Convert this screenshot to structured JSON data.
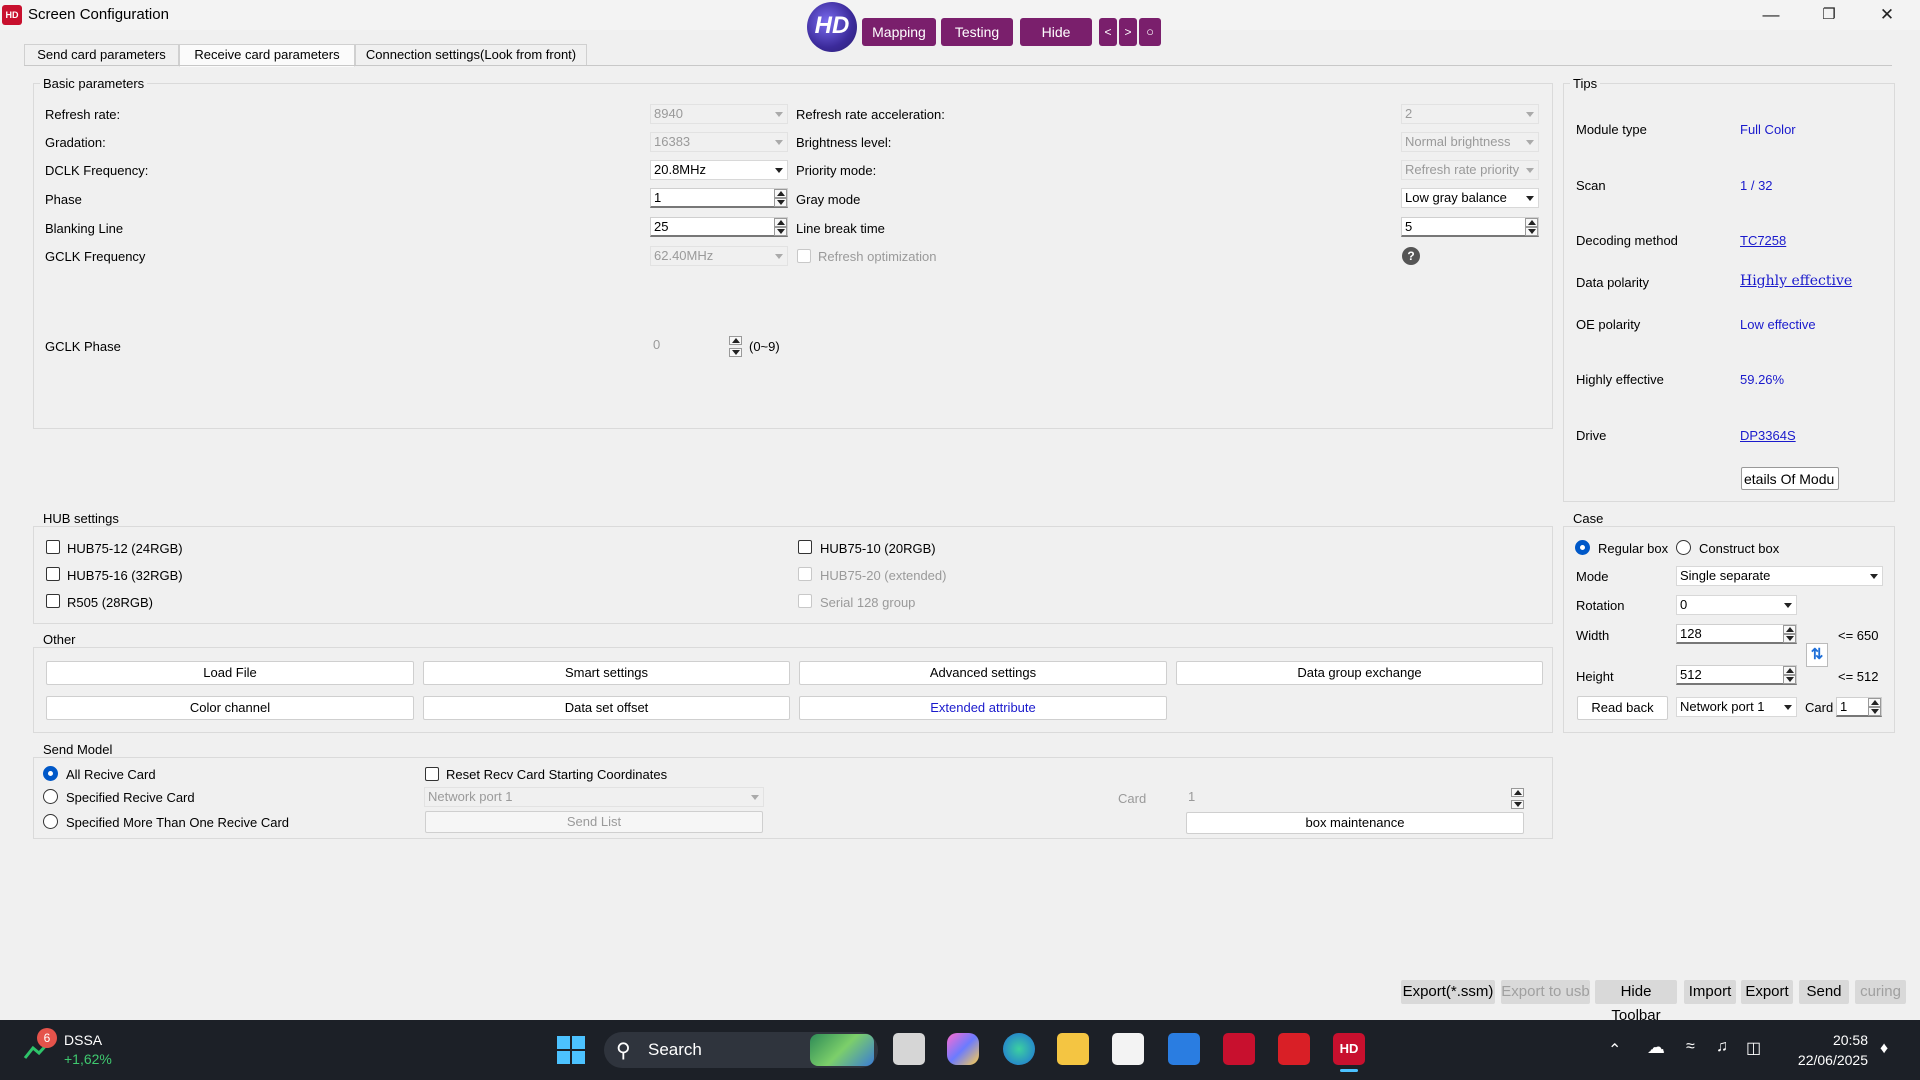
{
  "window": {
    "title": "Screen Configuration",
    "icon_text": "HD"
  },
  "toolbar": {
    "logo_text": "HD",
    "mapping": "Mapping",
    "testing": "Testing",
    "hide": "Hide",
    "prev": "<",
    "next": ">",
    "refresh": "○"
  },
  "tabs": [
    "Send card parameters",
    "Receive card parameters",
    "Connection settings(Look from front)"
  ],
  "basic": {
    "title": "Basic parameters",
    "refresh_rate_label": "Refresh rate:",
    "refresh_rate": "8940",
    "gradation_label": "Gradation:",
    "gradation": "16383",
    "dclk_label": "DCLK Frequency:",
    "dclk": "20.8MHz",
    "phase_label": "Phase",
    "phase": "1",
    "blanking_label": "Blanking Line",
    "blanking": "25",
    "gclk_freq_label": "GCLK Frequency",
    "gclk_freq": "62.40MHz",
    "gclk_phase_label": "GCLK Phase",
    "gclk_phase": "0",
    "gclk_phase_range": "(0~9)",
    "rra_label": "Refresh rate acceleration:",
    "rra": "2",
    "brightness_label": "Brightness level:",
    "brightness": "Normal brightness",
    "priority_label": "Priority mode:",
    "priority": "Refresh rate priority",
    "gray_label": "Gray mode",
    "gray": "Low gray balance",
    "linebreak_label": "Line break time",
    "linebreak": "5",
    "refresh_opt_label": "Refresh optimization",
    "help": "?"
  },
  "tips": {
    "title": "Tips",
    "module_type_label": "Module type",
    "module_type": "Full Color",
    "scan_label": "Scan",
    "scan": "1 / 32",
    "decoding_label": "Decoding method",
    "decoding": "TC7258",
    "data_polarity_label": "Data polarity",
    "data_polarity": "Highly effective",
    "oe_polarity_label": "OE polarity",
    "oe_polarity": "Low effective",
    "highly_label": "Highly effective",
    "highly": "59.26%",
    "drive_label": "Drive",
    "drive": "DP3364S",
    "details_btn": "etails Of Modu"
  },
  "hub": {
    "title": "HUB settings",
    "items": [
      "HUB75-12 (24RGB)",
      "HUB75-16 (32RGB)",
      "R505 (28RGB)",
      "HUB75-10 (20RGB)",
      "HUB75-20 (extended)",
      "Serial 128 group"
    ]
  },
  "other": {
    "title": "Other",
    "buttons": [
      "Load File",
      "Smart settings",
      "Advanced settings",
      "Data group exchange",
      "Color channel",
      "Data set offset",
      "Extended attribute"
    ]
  },
  "send_model": {
    "title": "Send Model",
    "all": "All Recive Card",
    "specified": "Specified Recive Card",
    "more": "Specified More Than One Recive Card",
    "reset": "Reset Recv Card Starting Coordinates",
    "network_port": "Network port 1",
    "send_list": "Send List",
    "card_label": "Card",
    "card": "1",
    "box_maintenance": "box maintenance"
  },
  "case": {
    "title": "Case",
    "regular": "Regular box",
    "construct": "Construct box",
    "mode_label": "Mode",
    "mode": "Single separate",
    "rotation_label": "Rotation",
    "rotation": "0",
    "width_label": "Width",
    "width": "128",
    "width_max": "<= 650",
    "height_label": "Height",
    "height": "512",
    "height_max": "<= 512",
    "read_back": "Read back",
    "port": "Network port 1",
    "card_label": "Card",
    "card": "1"
  },
  "bottom": [
    "Export(*.ssm)",
    "Export to usb",
    "Hide Toolbar",
    "Import",
    "Export",
    "Send",
    "curing"
  ],
  "taskbar": {
    "stock_badge": "6",
    "stock_name": "DSSA",
    "stock_change": "+1,62%",
    "search": "Search",
    "time": "20:58",
    "date": "22/06/2025"
  }
}
